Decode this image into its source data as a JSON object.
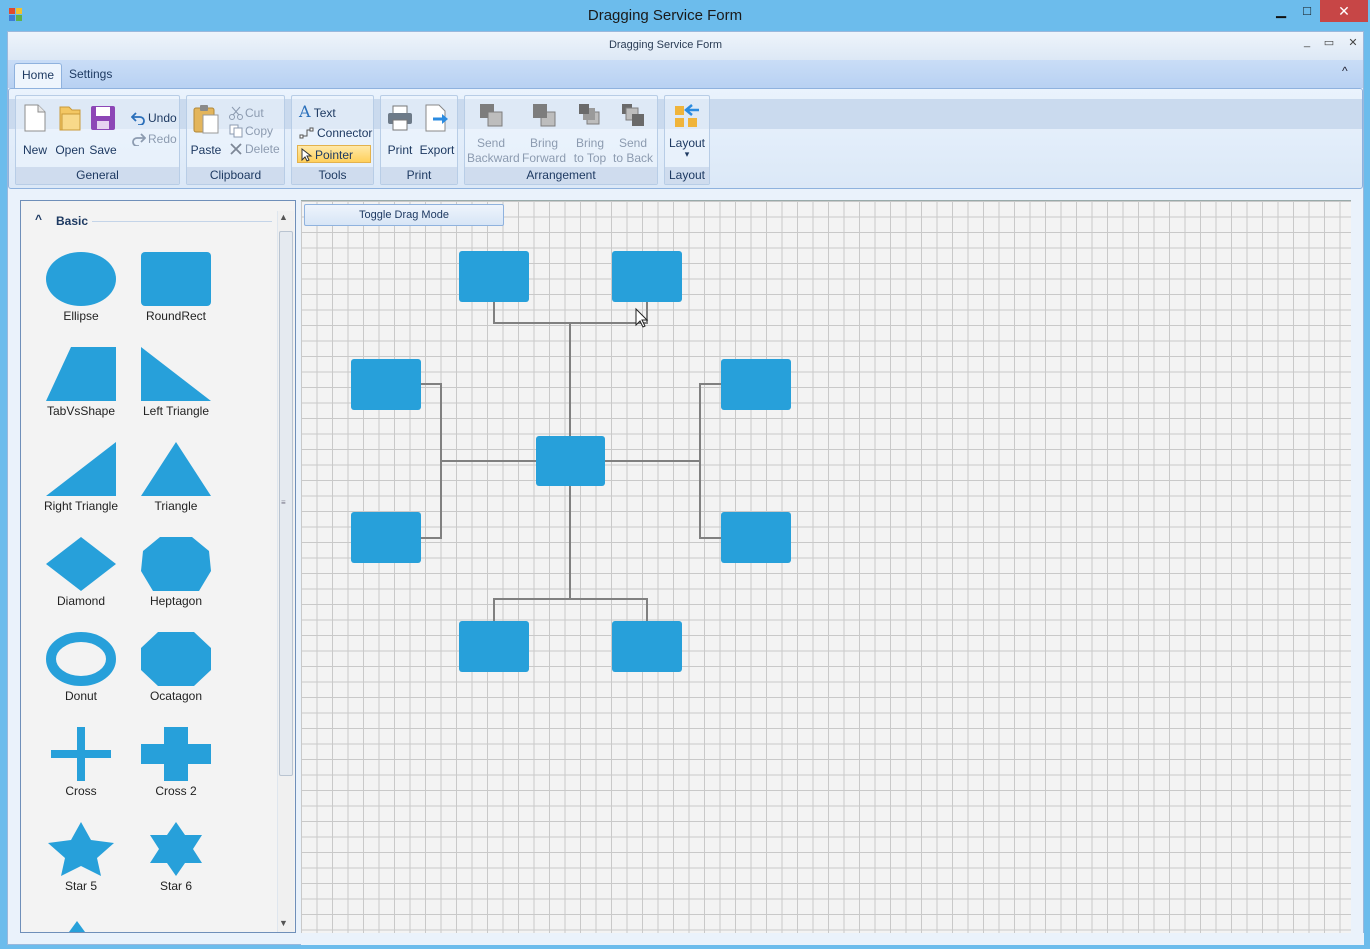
{
  "window": {
    "title": "Dragging Service Form",
    "minimize": "▁",
    "maximize": "□",
    "close": "✕"
  },
  "form": {
    "title": "Dragging Service Form",
    "minimize": "_",
    "maximize": "▭",
    "close": "✕"
  },
  "ribbon": {
    "tabs": [
      {
        "label": "Home",
        "active": true
      },
      {
        "label": "Settings",
        "active": false
      }
    ],
    "collapse_glyph": "^",
    "groups": {
      "general": {
        "label": "General",
        "new": "New",
        "open": "Open",
        "save": "Save",
        "undo": "Undo",
        "redo": "Redo"
      },
      "clipboard": {
        "label": "Clipboard",
        "paste": "Paste",
        "cut": "Cut",
        "copy": "Copy",
        "delete": "Delete"
      },
      "tools": {
        "label": "Tools",
        "text": "Text",
        "connector": "Connector",
        "pointer": "Pointer"
      },
      "print": {
        "label": "Print",
        "print": "Print",
        "export": "Export"
      },
      "arrangement": {
        "label": "Arrangement",
        "send_backward": [
          "Send",
          "Backward"
        ],
        "bring_forward": [
          "Bring",
          "Forward"
        ],
        "bring_to_top": [
          "Bring",
          "to Top"
        ],
        "send_to_back": [
          "Send",
          "to Back"
        ]
      },
      "layout": {
        "label": "Layout",
        "layout": "Layout",
        "dropdown": "▾"
      }
    }
  },
  "palette": {
    "header": "Basic",
    "header_glyph": "^",
    "accent_color": "#27a0da",
    "shapes": [
      {
        "name": "Ellipse",
        "icon": "ellipse-icon"
      },
      {
        "name": "RoundRect",
        "icon": "roundrect-icon"
      },
      {
        "name": "TabVsShape",
        "icon": "trapezoid-icon"
      },
      {
        "name": "Left Triangle",
        "icon": "left-triangle-icon"
      },
      {
        "name": "Right Triangle",
        "icon": "right-triangle-icon"
      },
      {
        "name": "Triangle",
        "icon": "triangle-icon"
      },
      {
        "name": "Diamond",
        "icon": "diamond-icon"
      },
      {
        "name": "Heptagon",
        "icon": "heptagon-icon"
      },
      {
        "name": "Donut",
        "icon": "donut-icon"
      },
      {
        "name": "Ocatagon",
        "icon": "octagon-icon"
      },
      {
        "name": "Cross",
        "icon": "cross-icon"
      },
      {
        "name": "Cross 2",
        "icon": "cross2-icon"
      },
      {
        "name": "Star 5",
        "icon": "star5-icon"
      },
      {
        "name": "Star 6",
        "icon": "star6-icon"
      }
    ],
    "scroll_up": "▲",
    "scroll_down": "▼",
    "scroll_grip": "≡"
  },
  "canvas": {
    "toggle_button": "Toggle Drag Mode",
    "node_color": "#27a0da",
    "connector_color": "#808080"
  }
}
